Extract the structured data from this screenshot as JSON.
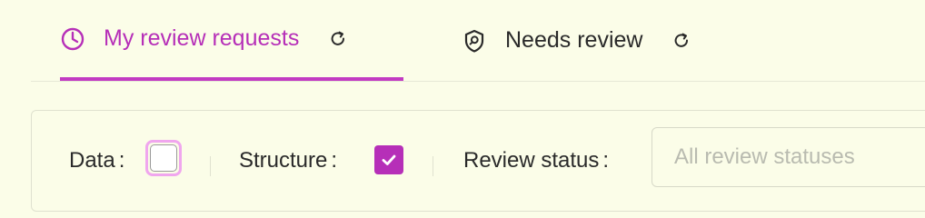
{
  "tabs": [
    {
      "label": "My review requests",
      "icon": "clock-icon",
      "active": true,
      "color": "#b62fb8"
    },
    {
      "label": "Needs review",
      "icon": "shield-search-icon",
      "active": false
    }
  ],
  "filters": {
    "data": {
      "label": "Data",
      "checked": false
    },
    "structure": {
      "label": "Structure",
      "checked": true
    },
    "review_status": {
      "label": "Review status",
      "placeholder": "All review statuses"
    },
    "colon": ":"
  },
  "colors": {
    "accent": "#b62fb8",
    "background": "#fbfde8",
    "focus_ring": "#f0a6ee"
  }
}
